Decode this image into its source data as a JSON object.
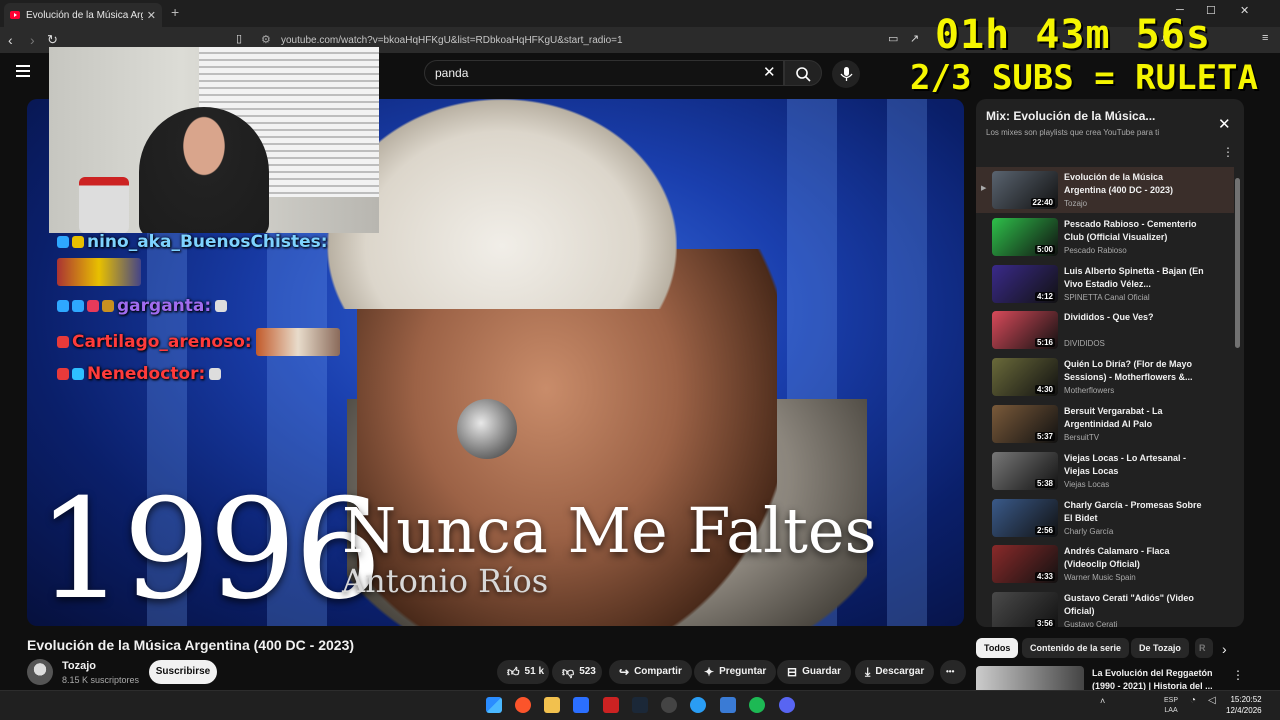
{
  "browser": {
    "tab_title": "Evolución de la Música Argentin",
    "tab_close": "✕",
    "new_tab": "+",
    "url": "youtube.com/watch?v=bkoaHqHFKgU&list=RDbkoaHqHFKgU&start_radio=1",
    "window_controls": [
      "─",
      "☐",
      "✕"
    ]
  },
  "youtube": {
    "search_value": "panda",
    "video_overlay": {
      "year": "1996",
      "song": "Nunca Me Faltes",
      "artist": "Antonio Ríos"
    },
    "video_title": "Evolución de la Música Argentina (400 DC - 2023)",
    "channel": {
      "name": "Tozajo",
      "subscribers": "8.15 K suscriptores",
      "subscribe_label": "Suscribirse"
    },
    "actions": {
      "like_count": "51 k",
      "dislike_count": "523",
      "share": "Compartir",
      "ask": "Preguntar",
      "save": "Guardar",
      "download": "Descargar",
      "more": "•••"
    }
  },
  "stream_overlay": {
    "timer": "01h 43m 56s",
    "subs_goal": "2/3 SUBS = RULETA",
    "chat": [
      {
        "user": "nino_aka_BuenosChistes:",
        "color": "#7ed3ff"
      },
      {
        "user": "garganta:",
        "color": "#a06cf0"
      },
      {
        "user": "Cartilago_arenoso:",
        "color": "#ff3b3b"
      },
      {
        "user": "Nenedoctor:",
        "color": "#ff3b3b"
      }
    ]
  },
  "playlist": {
    "title": "Mix: Evolución de la Música...",
    "subtitle": "Los mixes son playlists que crea YouTube para ti",
    "items": [
      {
        "title": "Evolución de la Música Argentina (400 DC - 2023)",
        "channel": "Tozajo",
        "duration": "22:40",
        "thumb": "#5a6470",
        "active": true
      },
      {
        "title": "Pescado Rabioso - Cementerio Club (Official Visualizer)",
        "channel": "Pescado Rabioso",
        "duration": "5:00",
        "thumb": "#2ec04a",
        "active": false
      },
      {
        "title": "Luis Alberto Spinetta - Bajan (En Vivo Estadio Vélez...",
        "channel": "SPINETTA Canal Oficial",
        "duration": "4:12",
        "thumb": "#3a2a8a",
        "active": false
      },
      {
        "title": "Divididos - Que Ves?",
        "channel": "DIVIDIDOS",
        "duration": "5:16",
        "thumb": "#d84a5a",
        "active": false
      },
      {
        "title": "Quién Lo Diría? (Flor de Mayo Sessions) - Motherflowers &...",
        "channel": "Motherflowers",
        "duration": "4:30",
        "thumb": "#6a6a3a",
        "active": false
      },
      {
        "title": "Bersuit Vergarabat - La Argentinidad Al Palo",
        "channel": "BersuitTV",
        "duration": "5:37",
        "thumb": "#7a5a3a",
        "active": false
      },
      {
        "title": "Viejas Locas - Lo Artesanal - Viejas Locas",
        "channel": "Viejas Locas",
        "duration": "5:38",
        "thumb": "#777777",
        "active": false
      },
      {
        "title": "Charly García - Promesas Sobre El Bidet",
        "channel": "Charly García",
        "duration": "2:56",
        "thumb": "#3a5a8a",
        "active": false
      },
      {
        "title": "Andrés Calamaro - Flaca (Videoclip Oficial)",
        "channel": "Warner Music Spain",
        "duration": "4:33",
        "thumb": "#8a2a2a",
        "active": false
      },
      {
        "title": "Gustavo Cerati \"Adiós\" (Video Oficial)",
        "channel": "Gustavo Cerati",
        "duration": "3:56",
        "thumb": "#4a4a4a",
        "active": false
      }
    ]
  },
  "chips": [
    "Todos",
    "Contenido de la serie",
    "De Tozajo",
    "R"
  ],
  "recommendation": {
    "title": "La Evolución del Reggaetón (1990 - 2021) | Historia del ..."
  },
  "taskbar": {
    "lang": "ESP",
    "lang2": "LAA",
    "time": "15:20:52",
    "date": "12/4/2026"
  }
}
